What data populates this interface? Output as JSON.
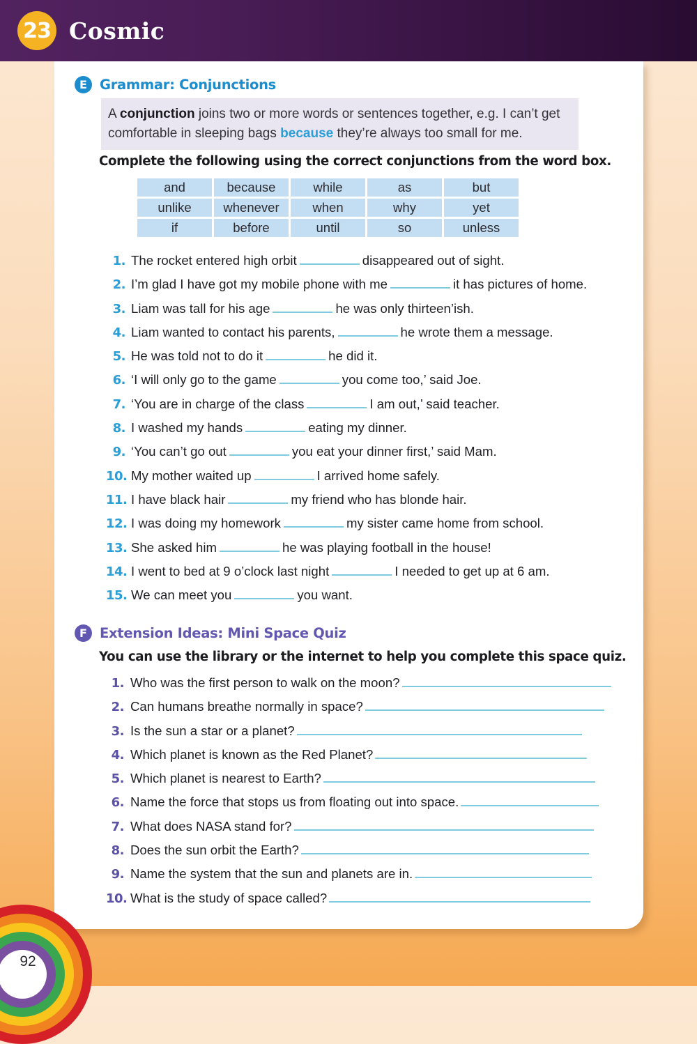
{
  "header": {
    "unit_number": "23",
    "unit_title": "Cosmic",
    "bar_color": "#4a1d57",
    "badge_color": "#f5b324"
  },
  "section_e": {
    "badge": "E",
    "badge_color": "#1c8ccd",
    "title": "Grammar: Conjunctions",
    "example": {
      "part1": "A ",
      "bold1": "conjunction",
      "part2": " joins two or more words or sentences together, e.g. I can’t get comfortable in sleeping bags ",
      "highlight": "because",
      "highlight_color": "#2a9ed6",
      "part3": " they’re always too small for me."
    },
    "instruction": "Complete the following using the correct conjunctions from the word box.",
    "word_box": [
      [
        "and",
        "because",
        "while",
        "as",
        "but"
      ],
      [
        "unlike",
        "whenever",
        "when",
        "why",
        "yet"
      ],
      [
        "if",
        "before",
        "until",
        "so",
        "unless"
      ]
    ],
    "word_box_bg": "#c3ddf2",
    "questions": [
      {
        "num": "1.",
        "pre": "The rocket entered high orbit",
        "post": "disappeared out of sight."
      },
      {
        "num": "2.",
        "pre": "I’m glad I have got my mobile phone with me",
        "post": "it has pictures of home."
      },
      {
        "num": "3.",
        "pre": "Liam was tall for his age",
        "post": "he was only thirteen’ish."
      },
      {
        "num": "4.",
        "pre": "Liam wanted to contact his parents,",
        "post": "he wrote them a message."
      },
      {
        "num": "5.",
        "pre": "He was told not to do it",
        "post": "he did it."
      },
      {
        "num": "6.",
        "pre": "‘I will only go to the game",
        "post": "you come too,’ said Joe."
      },
      {
        "num": "7.",
        "pre": "‘You are in charge of the class",
        "post": "I am out,’ said teacher."
      },
      {
        "num": "8.",
        "pre": "I washed my hands",
        "post": "eating my dinner."
      },
      {
        "num": "9.",
        "pre": "‘You can’t go out",
        "post": "you eat your dinner first,’ said Mam."
      },
      {
        "num": "10.",
        "pre": "My mother waited up",
        "post": "I arrived home safely."
      },
      {
        "num": "11.",
        "pre": "I have black hair",
        "post": "my friend who has blonde hair."
      },
      {
        "num": "12.",
        "pre": "I was doing my homework",
        "post": "my sister came home from school."
      },
      {
        "num": "13.",
        "pre": "She asked him",
        "post": "he was playing football in the house!"
      },
      {
        "num": "14.",
        "pre": "I went to bed at 9 o’clock last night",
        "post": "I needed to get up at 6 am."
      },
      {
        "num": "15.",
        "pre": "We can meet you",
        "post": "you want."
      }
    ]
  },
  "section_f": {
    "badge": "F",
    "badge_color": "#6257b0",
    "title": "Extension Ideas: Mini Space Quiz",
    "instruction": "You can use the library or the internet to help you complete this space quiz.",
    "questions": [
      {
        "num": "1.",
        "text": "Who was the first person to walk on the moon?",
        "line_width": 300
      },
      {
        "num": "2.",
        "text": "Can humans breathe normally in space?",
        "line_width": 343
      },
      {
        "num": "3.",
        "text": "Is the sun a star or a planet?",
        "line_width": 409
      },
      {
        "num": "4.",
        "text": "Which planet is known as the Red Planet?",
        "line_width": 304
      },
      {
        "num": "5.",
        "text": "Which planet is nearest to Earth?",
        "line_width": 390
      },
      {
        "num": "6.",
        "text": "Name the force that stops us from floating out into space.",
        "line_width": 198
      },
      {
        "num": "7.",
        "text": "What does NASA stand for?",
        "line_width": 430
      },
      {
        "num": "8.",
        "text": "Does the sun orbit the Earth?",
        "line_width": 413
      },
      {
        "num": "9.",
        "text": "Name the system that the sun and planets are in.",
        "line_width": 254
      },
      {
        "num": "10.",
        "text": "What is the study of space called?",
        "line_width": 375
      }
    ]
  },
  "footer": {
    "page_number": "92",
    "rainbow_colors": [
      "#d62027",
      "#f0821f",
      "#f9c51c",
      "#3aa650",
      "#7b4fa0"
    ]
  }
}
